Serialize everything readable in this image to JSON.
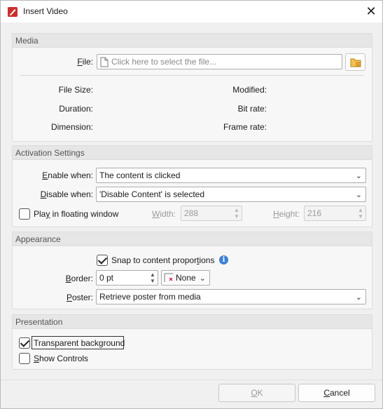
{
  "window": {
    "title": "Insert Video",
    "close_glyph": "✕"
  },
  "media": {
    "header": "Media",
    "file_label": "File:",
    "file_placeholder": "Click here to select the file...",
    "file_size_label": "File Size:",
    "modified_label": "Modified:",
    "duration_label": "Duration:",
    "bit_rate_label": "Bit rate:",
    "dimension_label": "Dimension:",
    "frame_rate_label": "Frame rate:"
  },
  "activation": {
    "header": "Activation Settings",
    "enable_label": "Enable when:",
    "enable_value": "The content is clicked",
    "disable_label": "Disable when:",
    "disable_value": "'Disable Content' is selected",
    "floating_label": "Play in floating window",
    "floating_checked": false,
    "width_label": "Width:",
    "width_value": "288",
    "height_label": "Height:",
    "height_value": "216"
  },
  "appearance": {
    "header": "Appearance",
    "snap_label": "Snap to content proportions",
    "snap_checked": true,
    "border_label": "Border:",
    "border_value": "0 pt",
    "border_style_value": "None",
    "poster_label": "Poster:",
    "poster_value": "Retrieve poster from media"
  },
  "presentation": {
    "header": "Presentation",
    "transparent_label": "Transparent background",
    "transparent_checked": true,
    "show_controls_label": "Show Controls",
    "show_controls_checked": false
  },
  "buttons": {
    "ok": "OK",
    "cancel": "Cancel"
  },
  "colors": {
    "accent": "#3b82d6",
    "app_icon": "#c9302c"
  }
}
